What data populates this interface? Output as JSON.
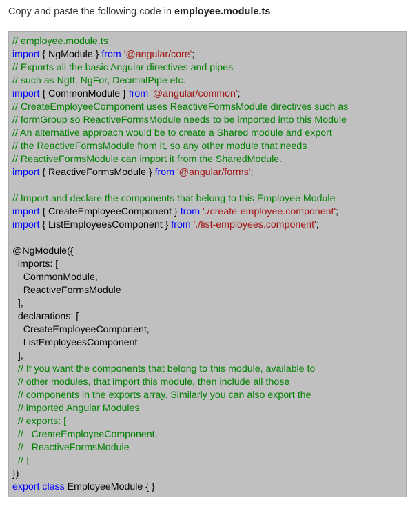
{
  "intro": {
    "prefix": "Copy and paste the following code in ",
    "filename": "employee.module.ts"
  },
  "code_lines": [
    [
      [
        "c",
        "// employee.module.ts"
      ]
    ],
    [
      [
        "k",
        "import"
      ],
      [
        "t",
        " { NgModule } "
      ],
      [
        "k",
        "from"
      ],
      [
        "t",
        " "
      ],
      [
        "s",
        "'@angular/core'"
      ],
      [
        "t",
        ";"
      ]
    ],
    [
      [
        "c",
        "// Exports all the basic Angular directives and pipes"
      ]
    ],
    [
      [
        "c",
        "// such as NgIf, NgFor, DecimalPipe etc."
      ]
    ],
    [
      [
        "k",
        "import"
      ],
      [
        "t",
        " { CommonModule } "
      ],
      [
        "k",
        "from"
      ],
      [
        "t",
        " "
      ],
      [
        "s",
        "'@angular/common'"
      ],
      [
        "t",
        ";"
      ]
    ],
    [
      [
        "c",
        "// CreateEmployeeComponent uses ReactiveFormsModule directives such as"
      ]
    ],
    [
      [
        "c",
        "// formGroup so ReactiveFormsModule needs to be imported into this Module"
      ]
    ],
    [
      [
        "c",
        "// An alternative approach would be to create a Shared module and export"
      ]
    ],
    [
      [
        "c",
        "// the ReactiveFormsModule from it, so any other module that needs"
      ]
    ],
    [
      [
        "c",
        "// ReactiveFormsModule can import it from the SharedModule."
      ]
    ],
    [
      [
        "k",
        "import"
      ],
      [
        "t",
        " { ReactiveFormsModule } "
      ],
      [
        "k",
        "from"
      ],
      [
        "t",
        " "
      ],
      [
        "s",
        "'@angular/forms'"
      ],
      [
        "t",
        ";"
      ]
    ],
    [],
    [
      [
        "c",
        "// Import and declare the components that belong to this Employee Module"
      ]
    ],
    [
      [
        "k",
        "import"
      ],
      [
        "t",
        " { CreateEmployeeComponent } "
      ],
      [
        "k",
        "from"
      ],
      [
        "t",
        " "
      ],
      [
        "s",
        "'./create-employee.component'"
      ],
      [
        "t",
        ";"
      ]
    ],
    [
      [
        "k",
        "import"
      ],
      [
        "t",
        " { ListEmployeesComponent } "
      ],
      [
        "k",
        "from"
      ],
      [
        "t",
        " "
      ],
      [
        "s",
        "'./list-employees.component'"
      ],
      [
        "t",
        ";"
      ]
    ],
    [],
    [
      [
        "t",
        "@NgModule({"
      ]
    ],
    [
      [
        "t",
        "  imports: ["
      ]
    ],
    [
      [
        "t",
        "    CommonModule,"
      ]
    ],
    [
      [
        "t",
        "    ReactiveFormsModule"
      ]
    ],
    [
      [
        "t",
        "  ],"
      ]
    ],
    [
      [
        "t",
        "  declarations: ["
      ]
    ],
    [
      [
        "t",
        "    CreateEmployeeComponent,"
      ]
    ],
    [
      [
        "t",
        "    ListEmployeesComponent"
      ]
    ],
    [
      [
        "t",
        "  ],"
      ]
    ],
    [
      [
        "t",
        "  "
      ],
      [
        "c",
        "// If you want the components that belong to this module, available to"
      ]
    ],
    [
      [
        "t",
        "  "
      ],
      [
        "c",
        "// other modules, that import this module, then include all those"
      ]
    ],
    [
      [
        "t",
        "  "
      ],
      [
        "c",
        "// components in the exports array. Similarly you can also export the"
      ]
    ],
    [
      [
        "t",
        "  "
      ],
      [
        "c",
        "// imported Angular Modules"
      ]
    ],
    [
      [
        "t",
        "  "
      ],
      [
        "c",
        "// exports: ["
      ]
    ],
    [
      [
        "t",
        "  "
      ],
      [
        "c",
        "//   CreateEmployeeComponent,"
      ]
    ],
    [
      [
        "t",
        "  "
      ],
      [
        "c",
        "//   ReactiveFormsModule"
      ]
    ],
    [
      [
        "t",
        "  "
      ],
      [
        "c",
        "// ]"
      ]
    ],
    [
      [
        "t",
        "})"
      ]
    ],
    [
      [
        "k",
        "export"
      ],
      [
        "t",
        " "
      ],
      [
        "k",
        "class"
      ],
      [
        "t",
        " EmployeeModule { }"
      ]
    ]
  ],
  "colors": {
    "comment": "#008000",
    "keyword": "#0000ff",
    "string": "#a31515",
    "text": "#000000",
    "code_background": "#c0c0c0"
  }
}
